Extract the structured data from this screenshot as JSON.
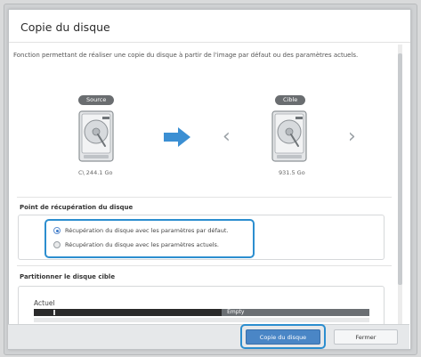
{
  "dialog": {
    "title": "Copie du disque",
    "description": "Fonction permettant de réaliser une copie du disque à partir de l'image par défaut ou des paramètres actuels."
  },
  "source": {
    "badge": "Source",
    "caption": "C\\ 244.1 Go"
  },
  "target": {
    "badge": "Cible",
    "caption": "931.5 Go"
  },
  "recovery": {
    "heading": "Point de récupération du disque",
    "options": [
      {
        "label": "Récupération du disque avec les paramètres par défaut.",
        "selected": true
      },
      {
        "label": "Récupération du disque avec les paramètres actuels.",
        "selected": false
      }
    ]
  },
  "partition": {
    "heading": "Partitionner le disque cible",
    "current_label": "Actuel",
    "free_label": "Empty",
    "used_fraction": 0.56
  },
  "footer": {
    "copy_label": "Copie du disque",
    "close_label": "Fermer"
  },
  "icons": {
    "arrow": "arrow-right-icon",
    "prev": "chevron-left-icon",
    "next": "chevron-right-icon",
    "drive": "hard-drive-icon"
  },
  "colors": {
    "accent": "#2c8ecf",
    "primary_button": "#4a86c6",
    "arrow": "#3b8fd3"
  }
}
